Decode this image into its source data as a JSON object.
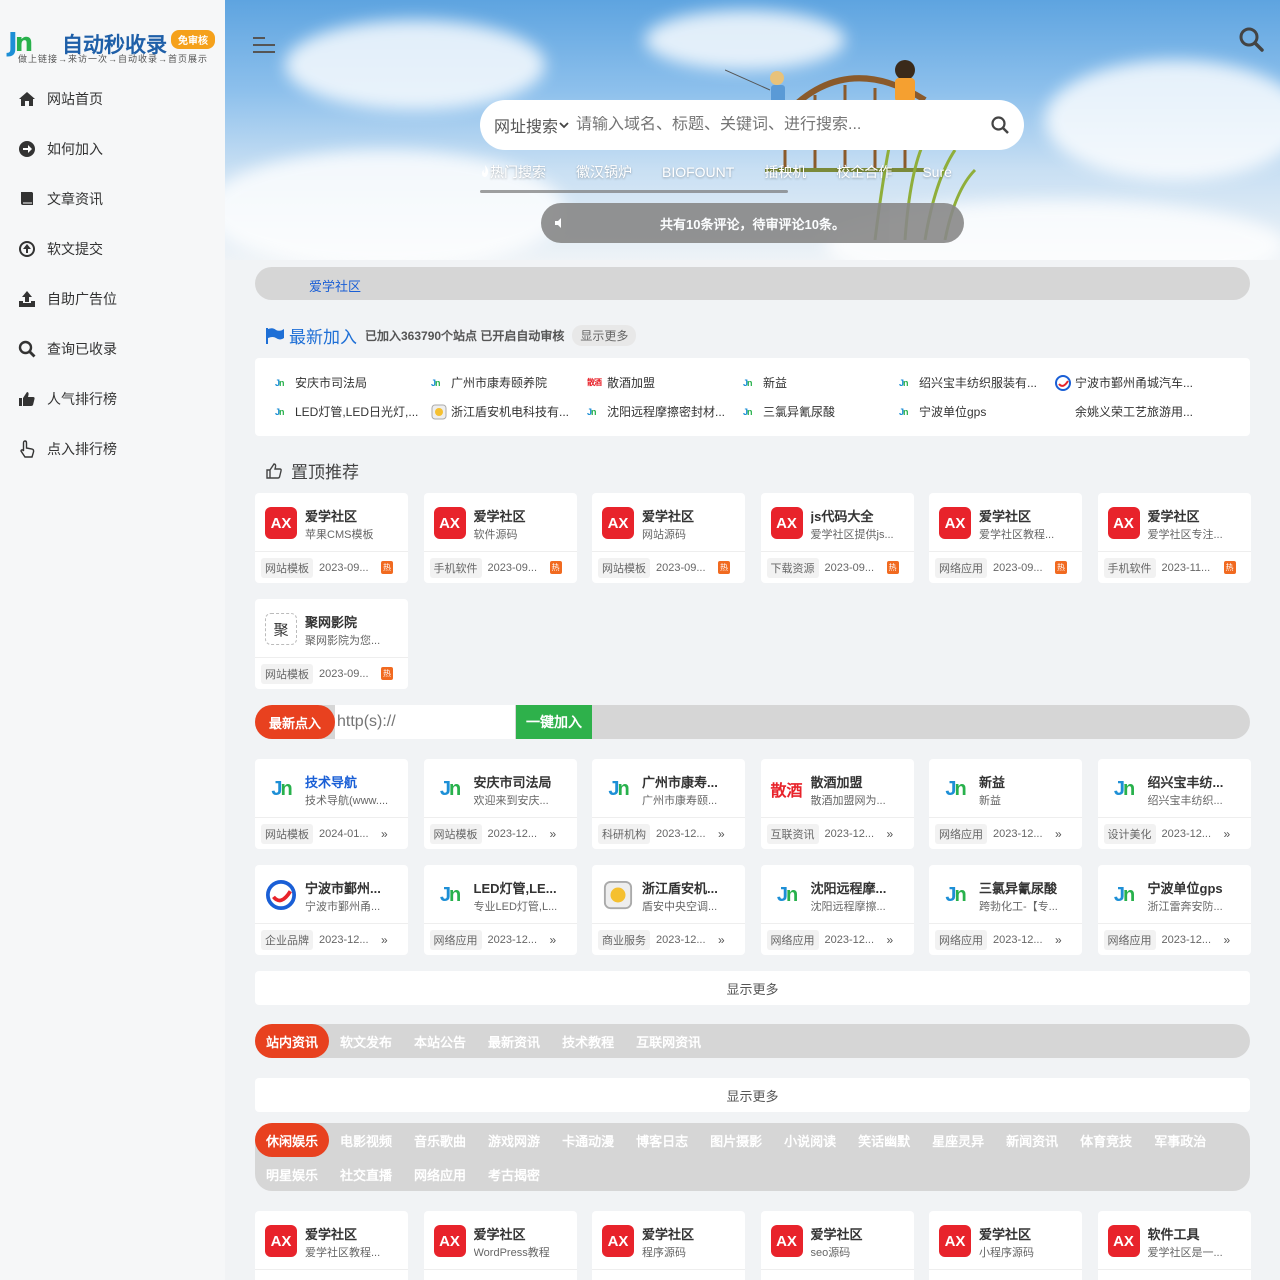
{
  "logo": {
    "mark_a": "J",
    "mark_b": "n",
    "title": "自动秒收录",
    "badge": "免审核",
    "subtitle": "做上链接→来访一次→自动收录→首页展示"
  },
  "nav": [
    {
      "label": "网站首页",
      "icon": "home-icon"
    },
    {
      "label": "如何加入",
      "icon": "arrow-circle-right-icon"
    },
    {
      "label": "文章资讯",
      "icon": "book-icon"
    },
    {
      "label": "软文提交",
      "icon": "arrow-circle-up-icon"
    },
    {
      "label": "自助广告位",
      "icon": "upload-icon"
    },
    {
      "label": "查询已收录",
      "icon": "search-icon"
    },
    {
      "label": "人气排行榜",
      "icon": "thumbs-up-icon"
    },
    {
      "label": "点入排行榜",
      "icon": "pointer-hand-icon"
    }
  ],
  "search": {
    "type": "网址搜索",
    "placeholder": "请输入域名、标题、关键词、进行搜索..."
  },
  "hot": [
    "热门搜索",
    "徽汉锅炉",
    "BIOFOUNT",
    "插秧机",
    "校企合作",
    "Sure"
  ],
  "notice": "共有10条评论，待审评论10条。",
  "ad": {
    "link": "爱学社区"
  },
  "latest": {
    "title": "最新加入",
    "meta": "已加入363790个站点 已开启自动审核",
    "more": "显示更多",
    "items": [
      {
        "name": "安庆市司法局",
        "logo": "jn"
      },
      {
        "name": "广州市康寿颐养院",
        "logo": "jn"
      },
      {
        "name": "散酒加盟",
        "logo": "sj"
      },
      {
        "name": "新益",
        "logo": "jn"
      },
      {
        "name": "绍兴宝丰纺织服装有...",
        "logo": "jn"
      },
      {
        "name": "宁波市鄞州甬城汽车...",
        "logo": "nb"
      },
      {
        "name": "LED灯管,LED日光灯,...",
        "logo": "jn"
      },
      {
        "name": "浙江盾安机电科技有...",
        "logo": "da"
      },
      {
        "name": "沈阳远程摩擦密封材...",
        "logo": "jn"
      },
      {
        "name": "三氯异氰尿酸",
        "logo": "jn"
      },
      {
        "name": "宁波单位gps",
        "logo": "jn"
      },
      {
        "name": "余姚义荣工艺旅游用...",
        "logo": "none"
      }
    ]
  },
  "top": {
    "title": "置顶推荐",
    "cards": [
      {
        "name": "爱学社区",
        "desc": "苹果CMS模板",
        "cat": "网站模板",
        "date": "2023-09..."
      },
      {
        "name": "爱学社区",
        "desc": "软件源码",
        "cat": "手机软件",
        "date": "2023-09..."
      },
      {
        "name": "爱学社区",
        "desc": "网站源码",
        "cat": "网站模板",
        "date": "2023-09..."
      },
      {
        "name": "js代码大全",
        "desc": "爱学社区提供js...",
        "cat": "下载资源",
        "date": "2023-09..."
      },
      {
        "name": "爱学社区",
        "desc": "爱学社区教程...",
        "cat": "网络应用",
        "date": "2023-09..."
      },
      {
        "name": "爱学社区",
        "desc": "爱学社区专注...",
        "cat": "手机软件",
        "date": "2023-11..."
      },
      {
        "name": "聚网影院",
        "desc": "聚网影院为您...",
        "cat": "网站模板",
        "date": "2023-09...",
        "icon_text": "聚"
      }
    ],
    "hot_badge": "热"
  },
  "submit": {
    "label": "最新点入",
    "placeholder": "http(s)://",
    "button": "一键加入"
  },
  "recent": [
    {
      "name": "技术导航",
      "desc": "技术导航(www....",
      "cat": "网站模板",
      "date": "2024-01...",
      "logo": "jn",
      "blue": true
    },
    {
      "name": "安庆市司法局",
      "desc": "欢迎来到安庆...",
      "cat": "网站模板",
      "date": "2023-12...",
      "logo": "jn"
    },
    {
      "name": "广州市康寿...",
      "desc": "广州市康寿颐...",
      "cat": "科研机构",
      "date": "2023-12...",
      "logo": "jn"
    },
    {
      "name": "散酒加盟",
      "desc": "散酒加盟网为...",
      "cat": "互联资讯",
      "date": "2023-12...",
      "logo": "sj",
      "logo_text": "散酒"
    },
    {
      "name": "新益",
      "desc": "新益",
      "cat": "网络应用",
      "date": "2023-12...",
      "logo": "jn"
    },
    {
      "name": "绍兴宝丰纺...",
      "desc": "绍兴宝丰纺织...",
      "cat": "设计美化",
      "date": "2023-12...",
      "logo": "jn"
    },
    {
      "name": "宁波市鄞州...",
      "desc": "宁波市鄞州甬...",
      "cat": "企业品牌",
      "date": "2023-12...",
      "logo": "nb"
    },
    {
      "name": "LED灯管,LE...",
      "desc": "专业LED灯管,L...",
      "cat": "网络应用",
      "date": "2023-12...",
      "logo": "jn"
    },
    {
      "name": "浙江盾安机...",
      "desc": "盾安中央空调...",
      "cat": "商业服务",
      "date": "2023-12...",
      "logo": "da"
    },
    {
      "name": "沈阳远程摩...",
      "desc": "沈阳远程摩擦...",
      "cat": "网络应用",
      "date": "2023-12...",
      "logo": "jn"
    },
    {
      "name": "三氯异氰尿酸",
      "desc": "跨勃化工-【专...",
      "cat": "网络应用",
      "date": "2023-12...",
      "logo": "jn"
    },
    {
      "name": "宁波单位gps",
      "desc": "浙江雷奔安防...",
      "cat": "网络应用",
      "date": "2023-12...",
      "logo": "jn"
    }
  ],
  "more1": "显示更多",
  "news_tabs": [
    "站内资讯",
    "软文发布",
    "本站公告",
    "最新资讯",
    "技术教程",
    "互联网资讯"
  ],
  "more2": "显示更多",
  "cat_tabs": [
    "休闲娱乐",
    "电影视频",
    "音乐歌曲",
    "游戏网游",
    "卡通动漫",
    "博客日志",
    "图片摄影",
    "小说阅读",
    "笑话幽默",
    "星座灵异",
    "新闻资讯",
    "体育竞技",
    "军事政治",
    "明星娱乐",
    "社交直播",
    "网络应用",
    "考古揭密"
  ],
  "bottom_cards": [
    {
      "name": "爱学社区",
      "desc": "爱学社区教程..."
    },
    {
      "name": "爱学社区",
      "desc": "WordPress教程"
    },
    {
      "name": "爱学社区",
      "desc": "程序源码"
    },
    {
      "name": "爱学社区",
      "desc": "seo源码"
    },
    {
      "name": "爱学社区",
      "desc": "小程序源码"
    },
    {
      "name": "软件工具",
      "desc": "爱学社区是一..."
    }
  ],
  "ax_text": "AX",
  "colors": {
    "accent": "#e8411f",
    "green": "#2eb14b",
    "link": "#1a5fd6",
    "ax": "#e8232b"
  }
}
